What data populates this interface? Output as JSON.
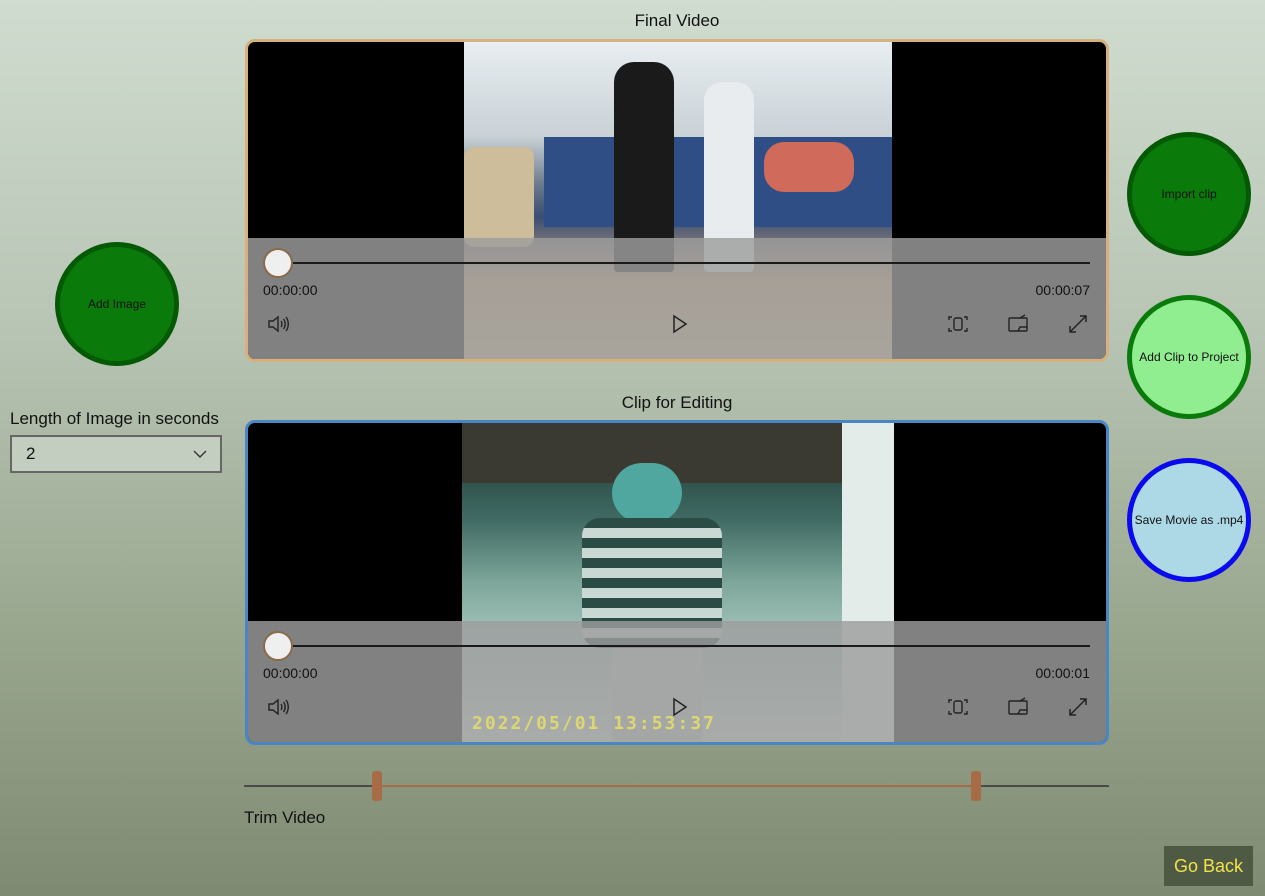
{
  "final_video": {
    "title": "Final Video",
    "time_current": "00:00:00",
    "time_total": "00:00:07",
    "progress": 0
  },
  "clip_editor": {
    "title": "Clip for Editing",
    "time_current": "00:00:00",
    "time_total": "00:00:01",
    "progress": 0,
    "timestamp_overlay": "2022/05/01  13:53:37"
  },
  "buttons": {
    "add_image": "Add Image",
    "import_clip": "Import clip",
    "add_clip": "Add Clip to Project",
    "save_movie": "Save Movie as .mp4",
    "go_back": "Go Back"
  },
  "image_length": {
    "label": "Length of Image in seconds",
    "selected": "2"
  },
  "trim": {
    "label": "Trim Video",
    "start_fraction": 0.154,
    "end_fraction": 0.845
  },
  "colors": {
    "accent_final": "#d6b07d",
    "accent_clip": "#4b86c4",
    "trim_color": "#a76b45",
    "go_back_text": "#f3e24a"
  },
  "icons": [
    "volume-icon",
    "play-icon",
    "aspect-ratio-icon",
    "cast-icon",
    "fullscreen-icon",
    "chevron-down-icon"
  ]
}
